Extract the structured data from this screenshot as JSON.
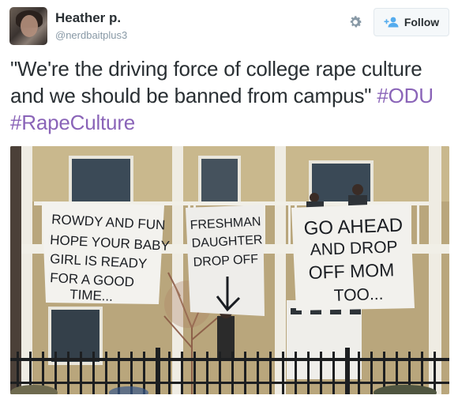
{
  "user": {
    "display_name": "Heather p.",
    "handle": "@nerdbaitplus3",
    "avatar_icon": "user-avatar"
  },
  "actions": {
    "settings_icon": "gear-icon",
    "follow_icon": "add-user-icon",
    "follow_label": "Follow"
  },
  "tweet": {
    "text": "\"We're the driving force of college rape culture and we should be banned from campus\"",
    "hashtags": [
      "#ODU",
      "#RapeCulture"
    ]
  },
  "media": {
    "banners": [
      {
        "lines": [
          "ROWDY AND FUN",
          "HOPE YOUR BABY",
          "GIRL IS READY",
          "FOR A GOOD",
          "TIME..."
        ]
      },
      {
        "lines": [
          "FRESHMAN",
          "DAUGHTER",
          "DROP OFF"
        ]
      },
      {
        "lines": [
          "GO AHEAD",
          "AND DROP",
          "OFF MOM",
          "TOO..."
        ]
      }
    ]
  },
  "colors": {
    "hashtag": "#8a64b8",
    "text": "#292f33",
    "muted": "#8899a6",
    "follow_icon": "#55acee"
  }
}
